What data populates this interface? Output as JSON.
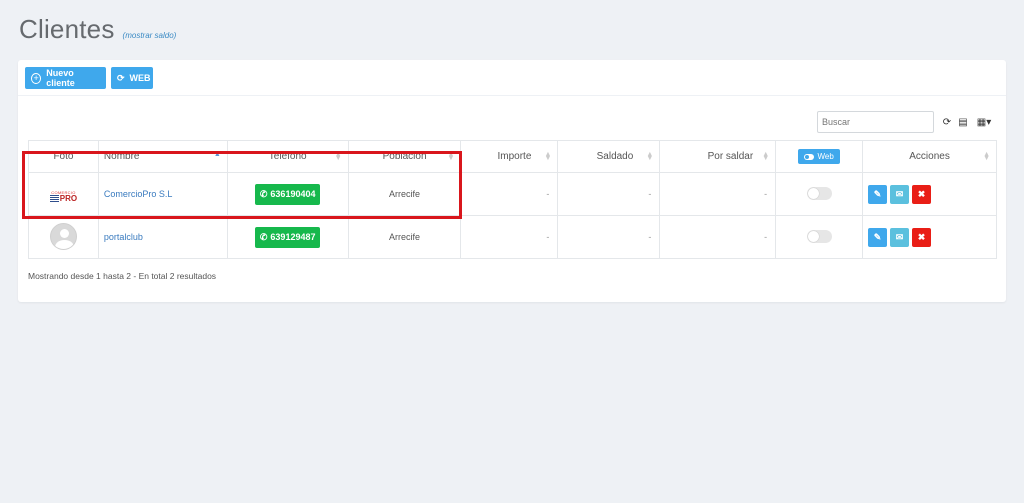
{
  "header": {
    "title": "Clientes",
    "balance_link": "(mostrar saldo)"
  },
  "toolbar": {
    "new_client": "Nuevo cliente",
    "web": "WEB"
  },
  "search": {
    "placeholder": "Buscar"
  },
  "table": {
    "columns": [
      "Foto",
      "Nombre",
      "Teléfono",
      "Población",
      "Importe",
      "Saldado",
      "Por saldar",
      "Web",
      "Acciones"
    ],
    "rows": [
      {
        "photo": "comerciopro-logo",
        "logo_top": "COMERCIO",
        "logo_bottom": "PRO",
        "name": "ComercioPro S.L",
        "phone": "636190404",
        "city": "Arrecife",
        "amount": "-",
        "paid": "-",
        "pending": "-",
        "web_enabled": false
      },
      {
        "photo": "default-avatar",
        "name": "portalclub",
        "phone": "639129487",
        "city": "Arrecife",
        "amount": "-",
        "paid": "-",
        "pending": "-",
        "web_enabled": false
      }
    ]
  },
  "footer": {
    "summary": "Mostrando desde 1 hasta 2 - En total 2 resultados"
  },
  "colors": {
    "accent": "#3fa8ec",
    "whatsapp": "#16b84c",
    "danger": "#e91e16",
    "highlight": "#d9161c"
  }
}
